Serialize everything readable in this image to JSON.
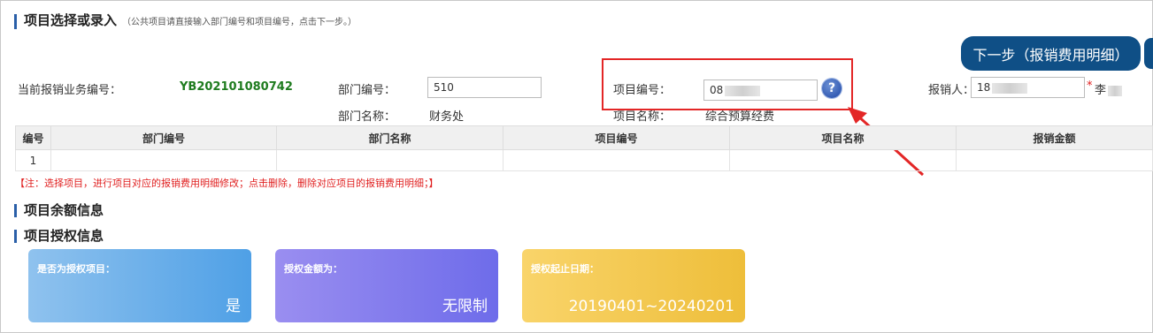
{
  "header": {
    "title": "项目选择或录入",
    "hint": "（公共项目请直接输入部门编号和项目编号，点击下一步。）",
    "next_button": "下一步（报销费用明细）"
  },
  "form": {
    "business_no_label": "当前报销业务编号：",
    "business_no_value": "YB202101080742",
    "dept_no_label": "部门编号：",
    "dept_no_value": "510",
    "dept_name_label": "部门名称：",
    "dept_name_value": "财务处",
    "project_no_label": "项目编号：",
    "project_no_value": "08",
    "project_name_label": "项目名称：",
    "project_name_value": "综合预算经费",
    "reimburser_label": "报销人：",
    "reimburser_value": "18",
    "required_mark": "*",
    "reimburser_name": "李"
  },
  "table": {
    "headers": [
      "编号",
      "部门编号",
      "部门名称",
      "项目编号",
      "项目名称",
      "报销金额"
    ],
    "rows": [
      [
        "1",
        "",
        "",
        "",
        "",
        ""
      ]
    ]
  },
  "note": "【注：选择项目，进行项目对应的报销费用明细修改；点击删除，删除对应项目的报销费用明细；】",
  "sections": {
    "balance": "项目余额信息",
    "auth": "项目授权信息"
  },
  "cards": [
    {
      "title": "是否为授权项目：",
      "value": "是"
    },
    {
      "title": "授权金额为：",
      "value": "无限制"
    },
    {
      "title": "授权起止日期：",
      "value": "20190401~20240201"
    }
  ],
  "icons": {
    "help": "help-question-icon",
    "arrow": "red-annotation-arrow"
  },
  "colors": {
    "accent": "#0f4f86",
    "highlight": "#e32626",
    "code_green": "#1e7b1e"
  }
}
